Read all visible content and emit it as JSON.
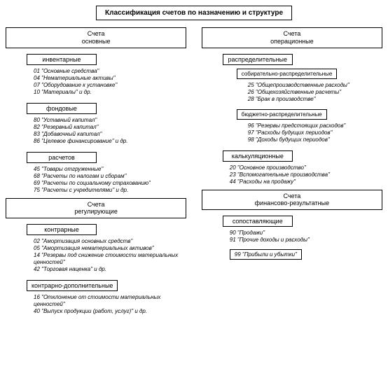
{
  "title": "Классификация счетов по назначению и структуре",
  "left": {
    "g1": {
      "label": "Счета\nосновные",
      "subs": [
        {
          "label": "инвентарные",
          "items": [
            "01 \"Основные средства\"",
            "04 \"Нематериальные активы\"",
            "07 \"Оборудование к установке\"",
            "10 \"Материалы\" и др."
          ]
        },
        {
          "label": "фондовые",
          "items": [
            "80 \"Уставный капитал\"",
            "82 \"Резервный капитал\"",
            "83 \"Добавочный капитал\"",
            "86 \"Целевое финансирование\" и др."
          ]
        },
        {
          "label": "расчетов",
          "items": [
            "45 \"Товары отгруженные\"",
            "68 \"Расчеты по налогам и сборам\"",
            "69 \"Расчеты по социальному страхованию\"",
            "75 \"Расчеты с учредителями\" и др."
          ]
        }
      ]
    },
    "g2": {
      "label": "Счета\nрегулирующие",
      "subs": [
        {
          "label": "контрарные",
          "items": [
            "02 \"Амортизация основных средств\"",
            "05 \"Амортизация нематериальных активов\"",
            "14 \"Резервы под снижение стоимости материальных ценностей\"",
            "42 \"Торговая наценка\" и др."
          ]
        },
        {
          "label": "контрарно-дополнительные",
          "items": [
            "16 \"Отклонение от стоимости материальных ценностей\"",
            "40 \"Выпуск продукции (работ, услуг)\" и др."
          ]
        }
      ]
    }
  },
  "right": {
    "g1": {
      "label": "Счета\nоперационные",
      "subs": [
        {
          "label": "распределительные",
          "children": [
            {
              "label": "собирательно-распределительные",
              "items": [
                "25 \"Общепроизводственные расходы\"",
                "26 \"Общехозяйственные расчеты\"",
                "28 \"Брак в производстве\""
              ]
            },
            {
              "label": "бюджетно-распределительные",
              "items": [
                "96 \"Резервы предстоящих расходов\"",
                "97 \"Расходы будущих периодов\"",
                "98 \"Доходы будущих периодов\""
              ]
            }
          ]
        },
        {
          "label": "калькуляционные",
          "items": [
            "20 \"Основное производство\"",
            "23 \"Вспомогательные производства\"",
            "44 \"Расходы на продажу\""
          ]
        }
      ]
    },
    "g2": {
      "label": "Счета\nфинансово-результатные",
      "subs": [
        {
          "label": "сопоставляющие",
          "items": [
            "90 \"Продажи\"",
            "91 \"Прочие доходы и расходы\""
          ]
        }
      ],
      "single": "99 \"Прибыли и убытки\""
    }
  }
}
